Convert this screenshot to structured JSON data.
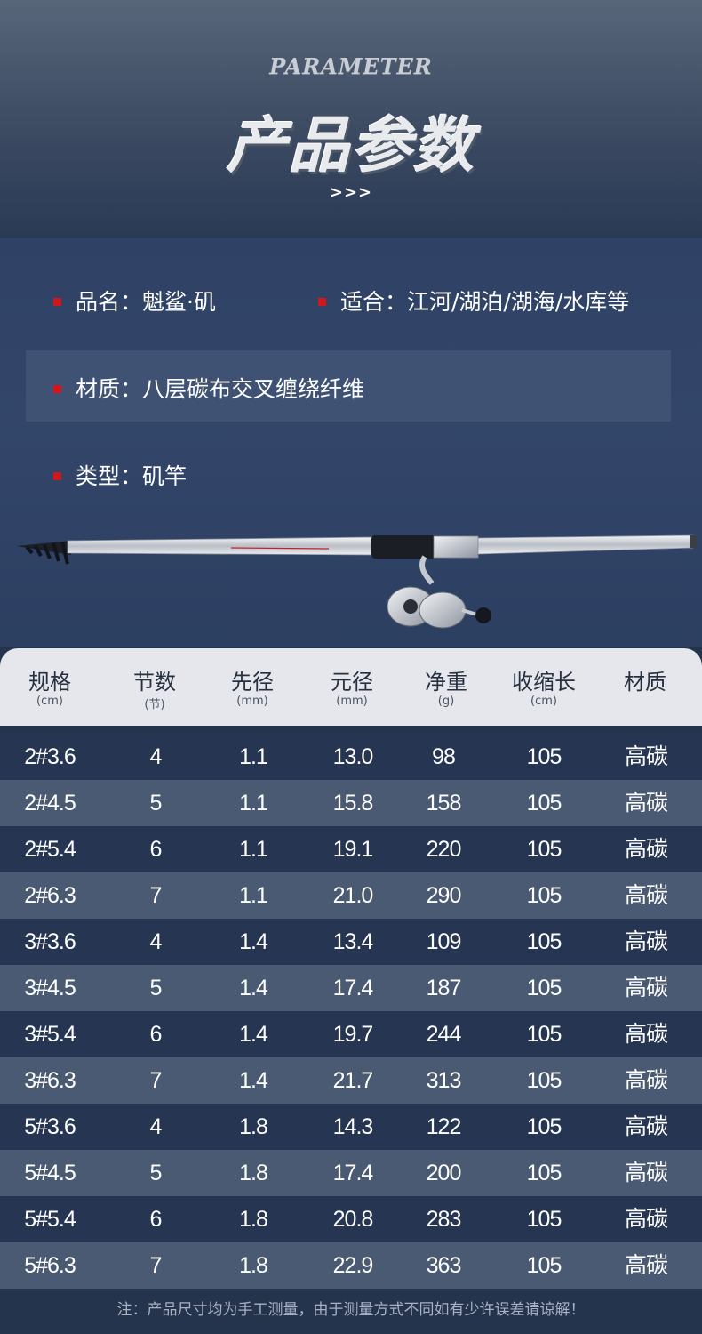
{
  "header": {
    "subtitle": "PARAMETER",
    "title": "产品参数",
    "arrows": ">>>"
  },
  "specs": {
    "name": "品名：魁鲨·矶",
    "suitable": "适合：江河/湖泊/湖海/水库等",
    "material": "材质：八层碳布交叉缠绕纤维",
    "type": "类型：矶竿"
  },
  "colors": {
    "accent_bullet": "#d3161b",
    "page_background": "#25344d",
    "row_dark": "#263552",
    "row_light": "#4a5a73",
    "header_band": "#e5e7ed"
  },
  "table": {
    "headers": [
      {
        "label": "规格",
        "unit": "(cm)"
      },
      {
        "label": "节数",
        "unit": "(节)"
      },
      {
        "label": "先径",
        "unit": "(mm)"
      },
      {
        "label": "元径",
        "unit": "(mm)"
      },
      {
        "label": "净重",
        "unit": "(g)"
      },
      {
        "label": "收缩长",
        "unit": "(cm)"
      },
      {
        "label": "材质",
        "unit": ""
      }
    ],
    "rows": [
      [
        "2#3.6",
        "4",
        "1.1",
        "13.0",
        "98",
        "105",
        "高碳"
      ],
      [
        "2#4.5",
        "5",
        "1.1",
        "15.8",
        "158",
        "105",
        "高碳"
      ],
      [
        "2#5.4",
        "6",
        "1.1",
        "19.1",
        "220",
        "105",
        "高碳"
      ],
      [
        "2#6.3",
        "7",
        "1.1",
        "21.0",
        "290",
        "105",
        "高碳"
      ],
      [
        "3#3.6",
        "4",
        "1.4",
        "13.4",
        "109",
        "105",
        "高碳"
      ],
      [
        "3#4.5",
        "5",
        "1.4",
        "17.4",
        "187",
        "105",
        "高碳"
      ],
      [
        "3#5.4",
        "6",
        "1.4",
        "19.7",
        "244",
        "105",
        "高碳"
      ],
      [
        "3#6.3",
        "7",
        "1.4",
        "21.7",
        "313",
        "105",
        "高碳"
      ],
      [
        "5#3.6",
        "4",
        "1.8",
        "14.3",
        "122",
        "105",
        "高碳"
      ],
      [
        "5#4.5",
        "5",
        "1.8",
        "17.4",
        "200",
        "105",
        "高碳"
      ],
      [
        "5#5.4",
        "6",
        "1.8",
        "20.8",
        "283",
        "105",
        "高碳"
      ],
      [
        "5#6.3",
        "7",
        "1.8",
        "22.9",
        "363",
        "105",
        "高碳"
      ]
    ]
  },
  "footnote": "注：产品尺寸均为手工测量，由于测量方式不同如有少许误差请谅解！"
}
